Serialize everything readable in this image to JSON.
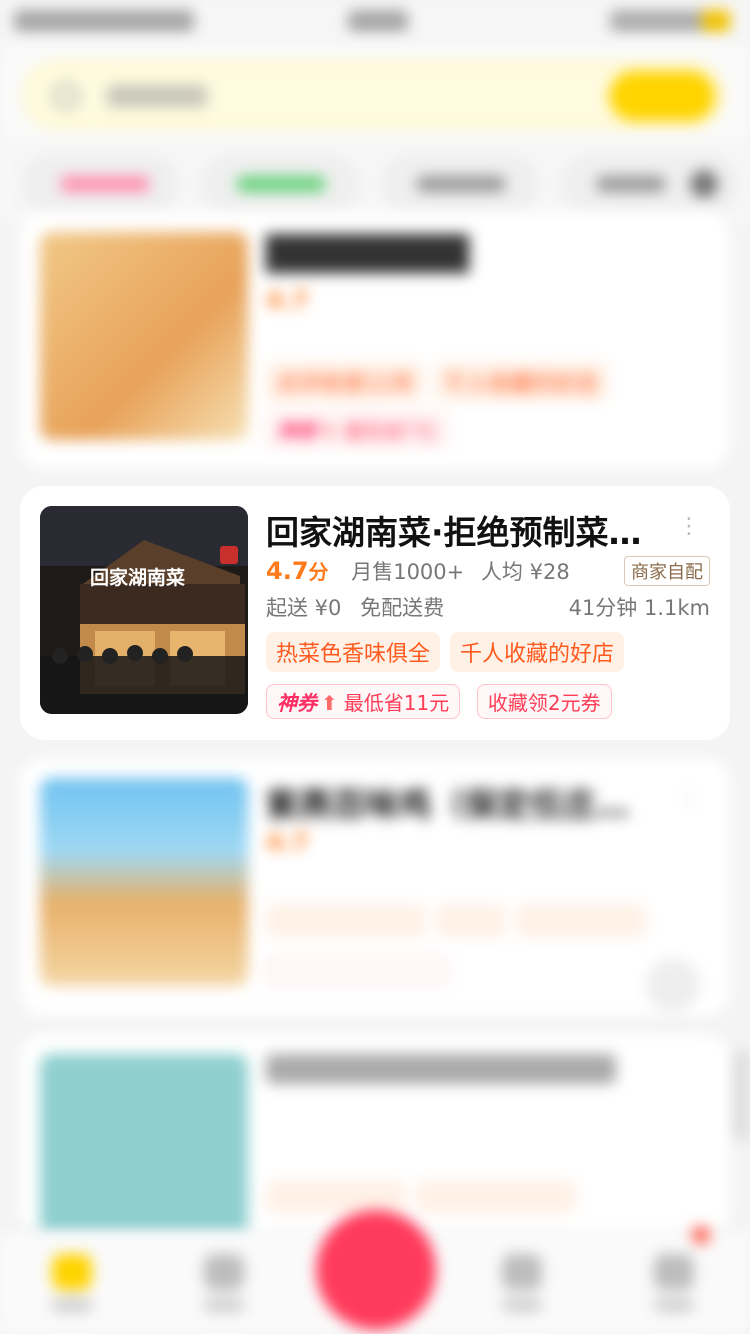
{
  "colors": {
    "accent": "#ff7a1a",
    "brand_yellow": "#ffd400",
    "fab": "#ff3b5c",
    "coupon_red": "#ff3d57"
  },
  "shop": {
    "title": "回家湖南菜·拒绝预制菜…",
    "rating": "4.7",
    "rating_unit": "分",
    "monthly_sales": "月售1000+",
    "avg_price": "人均 ¥28",
    "delivery_tag": "商家自配",
    "min_order": "起送 ¥0",
    "delivery_fee": "免配送费",
    "eta_distance": "41分钟 1.1km",
    "tags": [
      "热菜色香味俱全",
      "千人收藏的好店"
    ],
    "coupon_label": "神券",
    "coupon_text": "最低省11元",
    "collect_coupon": "收藏领2元券",
    "sign_text": "回家湖南菜"
  },
  "top_card": {
    "rating": "4.7",
    "tags": [
      "点评收录11年",
      "千人收藏的好店"
    ],
    "coupon_label": "神券",
    "coupon_text": "最低省7元"
  },
  "third_card": {
    "title": "紫燕百味鸡（保定任庄…",
    "rating": "4.7"
  }
}
